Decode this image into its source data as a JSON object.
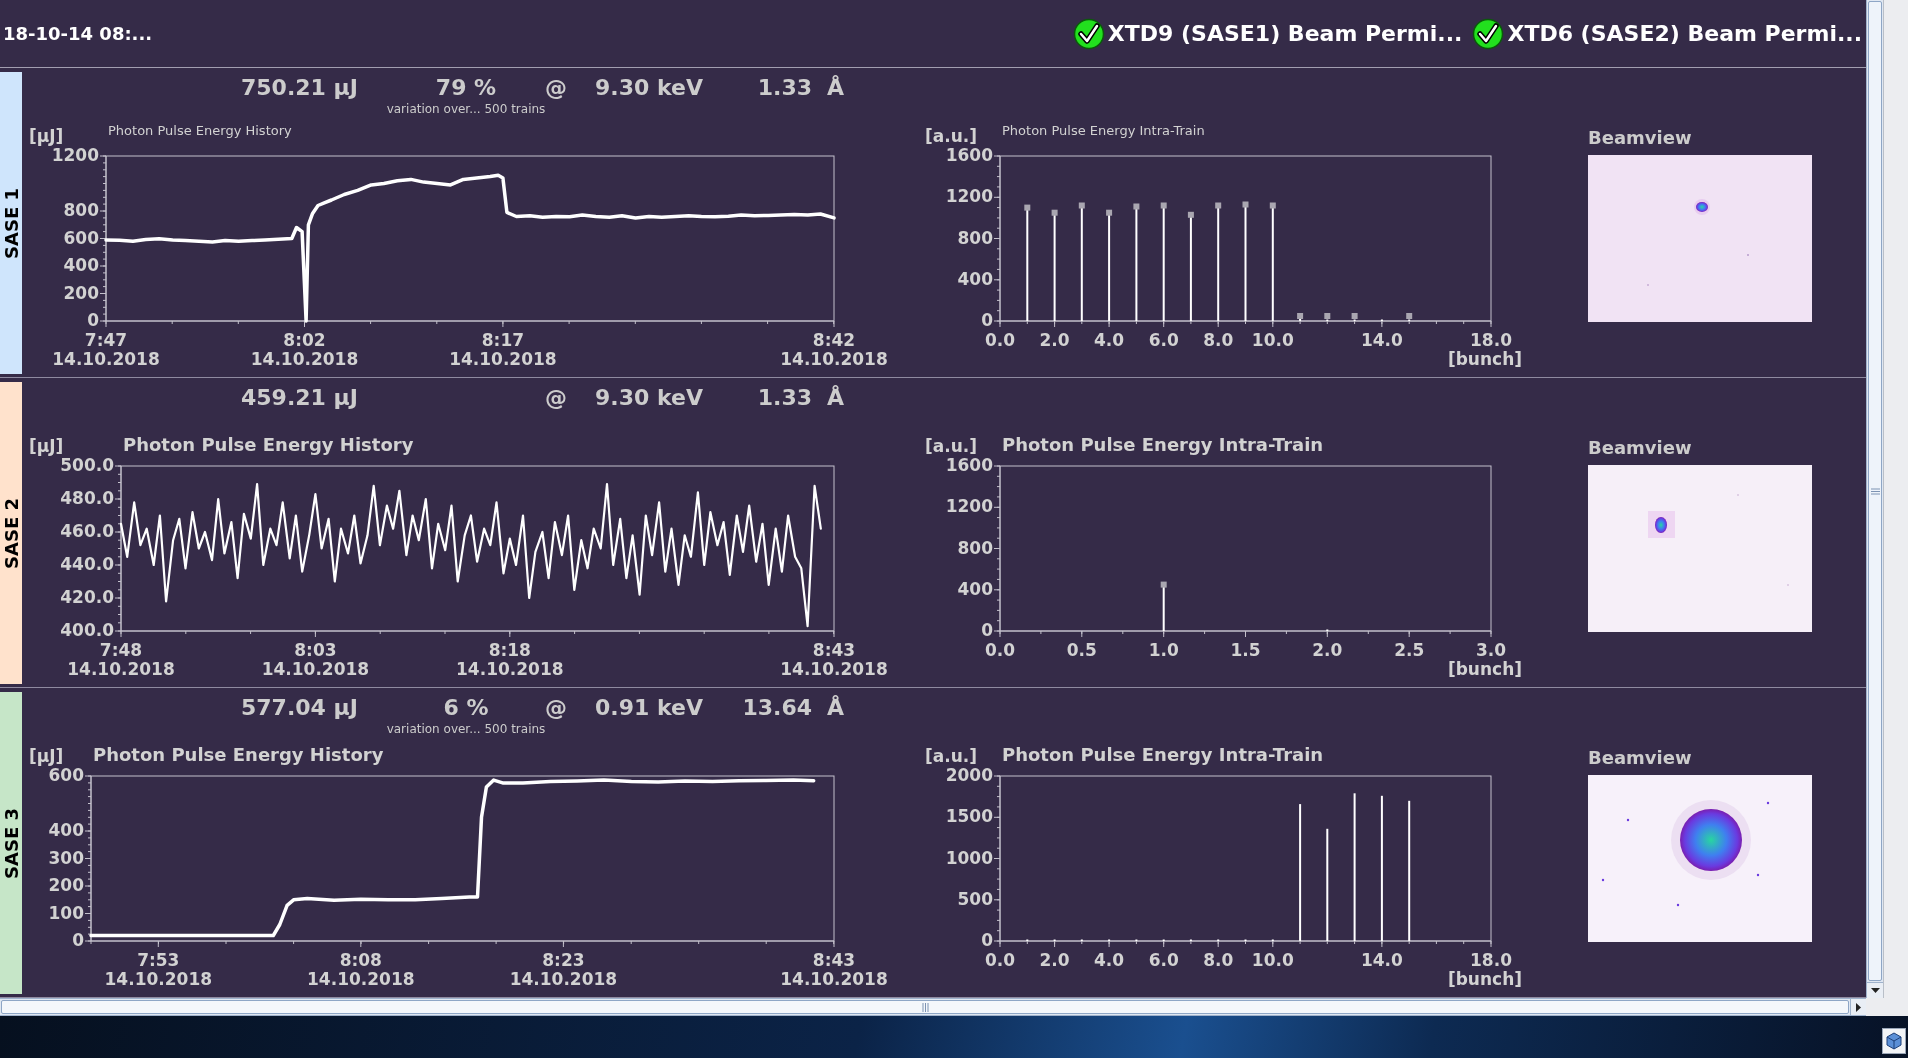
{
  "top_bar": {
    "timestamp": "18-10-14 08:...",
    "statuses": [
      {
        "label": "XTD9 (SASE1) Beam Permi...",
        "ok": true
      },
      {
        "label": "XTD6 (SASE2) Beam Permi...",
        "ok": true
      }
    ]
  },
  "panels": [
    {
      "label": "SASE 1",
      "color": "#cfe5fc",
      "header": {
        "energy": "750.21 µJ",
        "variation": {
          "value": "79 %",
          "note": "variation over... 500 trains"
        },
        "at": "@",
        "photon_energy": "9.30 keV",
        "wavelength": "1.33",
        "wavelength_unit": "Å"
      },
      "history": {
        "title_bold": false,
        "x_tick_dates": [
          "14.10.2018",
          "14.10.2018",
          "14.10.2018",
          "14.10.2018"
        ],
        "chart_data": {
          "type": "line",
          "title": "Photon Pulse Energy History",
          "ylabel": "[µJ]",
          "xlim": [
            7.783,
            8.7
          ],
          "ylim": [
            0,
            1200
          ],
          "yticks": [
            0,
            200,
            400,
            600,
            800,
            1200
          ],
          "xticks": [
            {
              "value": 7.783,
              "label": "7:47"
            },
            {
              "value": 8.033,
              "label": "8:02"
            },
            {
              "value": 8.283,
              "label": "8:17"
            },
            {
              "value": 8.7,
              "label": "8:42"
            }
          ],
          "x": [
            7.783,
            7.8,
            7.817,
            7.833,
            7.85,
            7.867,
            7.883,
            7.9,
            7.917,
            7.933,
            7.95,
            7.967,
            7.983,
            8.0,
            8.017,
            8.023,
            8.03,
            8.035,
            8.038,
            8.043,
            8.05,
            8.058,
            8.067,
            8.083,
            8.1,
            8.117,
            8.133,
            8.15,
            8.167,
            8.183,
            8.2,
            8.217,
            8.233,
            8.25,
            8.267,
            8.277,
            8.283,
            8.288,
            8.3,
            8.317,
            8.333,
            8.35,
            8.367,
            8.383,
            8.4,
            8.417,
            8.433,
            8.45,
            8.467,
            8.483,
            8.5,
            8.517,
            8.533,
            8.55,
            8.567,
            8.583,
            8.6,
            8.617,
            8.633,
            8.65,
            8.667,
            8.683,
            8.7
          ],
          "series": [
            {
              "color": "#ffffff",
              "values": [
                590,
                588,
                580,
                592,
                598,
                590,
                585,
                580,
                575,
                585,
                580,
                585,
                590,
                595,
                600,
                680,
                650,
                0,
                700,
                780,
                840,
                860,
                880,
                920,
                950,
                990,
                1000,
                1020,
                1030,
                1010,
                1000,
                990,
                1030,
                1040,
                1050,
                1060,
                1040,
                790,
                760,
                765,
                755,
                760,
                758,
                770,
                760,
                755,
                765,
                750,
                760,
                755,
                760,
                765,
                760,
                758,
                762,
                770,
                765,
                768,
                772,
                775,
                770,
                778,
                750
              ]
            }
          ]
        }
      },
      "intra_train": {
        "title_bold": false,
        "stem_markers": true,
        "chart_data": {
          "type": "bar",
          "title": "Photon Pulse Energy Intra-Train",
          "ylabel": "[a.u.]",
          "xlabel": "[bunch]",
          "xlim": [
            0,
            18
          ],
          "ylim": [
            0,
            1600
          ],
          "yticks": [
            0,
            400,
            800,
            1200,
            1600
          ],
          "xticks": [
            {
              "value": 0,
              "label": "0.0"
            },
            {
              "value": 2,
              "label": "2.0"
            },
            {
              "value": 4,
              "label": "4.0"
            },
            {
              "value": 6,
              "label": "6.0"
            },
            {
              "value": 8,
              "label": "8.0"
            },
            {
              "value": 10,
              "label": "10.0"
            },
            {
              "value": 14,
              "label": "14.0"
            },
            {
              "value": 18,
              "label": "18.0"
            }
          ],
          "x": [
            1,
            2,
            3,
            4,
            5,
            6,
            7,
            8,
            9,
            10,
            11,
            12,
            13,
            14,
            15
          ],
          "series": [
            {
              "color": "#ffffff",
              "values": [
                1100,
                1050,
                1120,
                1050,
                1110,
                1120,
                1030,
                1120,
                1130,
                1120,
                20,
                10,
                10,
                0,
                10
              ]
            }
          ]
        }
      },
      "beamview": {
        "title": "Beamview"
      }
    },
    {
      "label": "SASE 2",
      "color": "#ffe2cc",
      "header": {
        "energy": "459.21 µJ",
        "at": "@",
        "photon_energy": "9.30 keV",
        "wavelength": "1.33",
        "wavelength_unit": "Å"
      },
      "history": {
        "title_bold": true,
        "x_tick_dates": [
          "14.10.2018",
          "14.10.2018",
          "14.10.2018",
          "14.10.2018"
        ],
        "chart_data": {
          "type": "line",
          "title": "Photon Pulse Energy History",
          "ylabel": "[µJ]",
          "xlim": [
            7.8,
            8.717
          ],
          "ylim": [
            400,
            500
          ],
          "yticks": [
            {
              "value": 400,
              "label": "400.0"
            },
            {
              "value": 420,
              "label": "420.0"
            },
            {
              "value": 440,
              "label": "440.0"
            },
            {
              "value": 460,
              "label": "460.0"
            },
            {
              "value": 480,
              "label": "480.0"
            },
            {
              "value": 500,
              "label": "500.0"
            }
          ],
          "xticks": [
            {
              "value": 7.8,
              "label": "7:48"
            },
            {
              "value": 8.05,
              "label": "8:03"
            },
            {
              "value": 8.3,
              "label": "8:18"
            },
            {
              "value": 8.717,
              "label": "8:43"
            }
          ],
          "x": [
            7.8,
            7.808,
            7.817,
            7.825,
            7.833,
            7.842,
            7.85,
            7.858,
            7.867,
            7.875,
            7.883,
            7.892,
            7.9,
            7.908,
            7.917,
            7.925,
            7.933,
            7.942,
            7.95,
            7.958,
            7.967,
            7.975,
            7.983,
            7.992,
            8.0,
            8.008,
            8.017,
            8.025,
            8.033,
            8.042,
            8.05,
            8.058,
            8.067,
            8.075,
            8.083,
            8.092,
            8.1,
            8.108,
            8.117,
            8.125,
            8.133,
            8.142,
            8.15,
            8.158,
            8.167,
            8.175,
            8.183,
            8.192,
            8.2,
            8.208,
            8.217,
            8.225,
            8.233,
            8.242,
            8.25,
            8.258,
            8.267,
            8.275,
            8.283,
            8.292,
            8.3,
            8.308,
            8.317,
            8.325,
            8.333,
            8.342,
            8.35,
            8.358,
            8.367,
            8.375,
            8.383,
            8.392,
            8.4,
            8.408,
            8.417,
            8.425,
            8.433,
            8.442,
            8.45,
            8.458,
            8.467,
            8.475,
            8.483,
            8.492,
            8.5,
            8.508,
            8.517,
            8.525,
            8.533,
            8.542,
            8.55,
            8.558,
            8.567,
            8.575,
            8.583,
            8.592,
            8.6,
            8.608,
            8.617,
            8.625,
            8.633,
            8.642,
            8.65,
            8.658,
            8.667,
            8.675,
            8.683,
            8.692,
            8.7
          ],
          "series": [
            {
              "color": "#ffffff",
              "values": [
                465,
                445,
                478,
                452,
                462,
                440,
                470,
                418,
                455,
                468,
                438,
                472,
                450,
                460,
                443,
                480,
                447,
                466,
                432,
                471,
                456,
                489,
                440,
                462,
                452,
                478,
                444,
                470,
                436,
                458,
                483,
                450,
                468,
                430,
                462,
                447,
                470,
                441,
                458,
                488,
                452,
                476,
                462,
                485,
                446,
                470,
                455,
                480,
                438,
                465,
                449,
                476,
                430,
                458,
                470,
                442,
                462,
                452,
                478,
                435,
                456,
                440,
                470,
                420,
                448,
                460,
                432,
                466,
                446,
                470,
                425,
                455,
                438,
                462,
                450,
                489,
                440,
                468,
                432,
                458,
                422,
                470,
                446,
                478,
                436,
                462,
                428,
                458,
                445,
                484,
                440,
                472,
                452,
                466,
                434,
                470,
                448,
                476,
                442,
                465,
                428,
                462,
                436,
                470,
                445,
                438,
                403,
                488,
                462
              ]
            }
          ]
        }
      },
      "intra_train": {
        "title_bold": true,
        "stem_markers": true,
        "chart_data": {
          "type": "bar",
          "title": "Photon Pulse Energy Intra-Train",
          "ylabel": "[a.u.]",
          "xlabel": "[bunch]",
          "xlim": [
            0,
            3
          ],
          "ylim": [
            0,
            1600
          ],
          "yticks": [
            0,
            400,
            800,
            1200,
            1600
          ],
          "xticks": [
            {
              "value": 0,
              "label": "0.0"
            },
            {
              "value": 0.5,
              "label": "0.5"
            },
            {
              "value": 1,
              "label": "1.0"
            },
            {
              "value": 1.5,
              "label": "1.5"
            },
            {
              "value": 2,
              "label": "2.0"
            },
            {
              "value": 2.5,
              "label": "2.5"
            },
            {
              "value": 3,
              "label": "3.0"
            }
          ],
          "x": [
            1,
            2
          ],
          "series": [
            {
              "color": "#ffffff",
              "values": [
                450,
                0
              ]
            }
          ]
        }
      },
      "beamview": {
        "title": "Beamview"
      }
    },
    {
      "label": "SASE 3",
      "color": "#c6e6c8",
      "header": {
        "energy": "577.04 µJ",
        "variation": {
          "value": "6 %",
          "note": "variation over... 500 trains"
        },
        "at": "@",
        "photon_energy": "0.91 keV",
        "wavelength": "13.64",
        "wavelength_unit": "Å"
      },
      "history": {
        "title_bold": true,
        "x_tick_dates": [
          "14.10.2018",
          "14.10.2018",
          "14.10.2018",
          "14.10.2018"
        ],
        "chart_data": {
          "type": "line",
          "title": "Photon Pulse Energy History",
          "ylabel": "[µJ]",
          "xlim": [
            7.8,
            8.717
          ],
          "ylim": [
            0,
            600
          ],
          "yticks": [
            0,
            100,
            200,
            300,
            400,
            600
          ],
          "xticks": [
            {
              "value": 7.883,
              "label": "7:53"
            },
            {
              "value": 8.133,
              "label": "8:08"
            },
            {
              "value": 8.383,
              "label": "8:23"
            },
            {
              "value": 8.717,
              "label": "8:43"
            }
          ],
          "x": [
            7.8,
            7.883,
            7.967,
            8.025,
            8.033,
            8.042,
            8.05,
            8.067,
            8.1,
            8.133,
            8.167,
            8.2,
            8.233,
            8.267,
            8.277,
            8.282,
            8.288,
            8.297,
            8.308,
            8.333,
            8.367,
            8.4,
            8.433,
            8.467,
            8.5,
            8.533,
            8.567,
            8.6,
            8.633,
            8.667,
            8.692
          ],
          "series": [
            {
              "color": "#ffffff",
              "values": [
                20,
                20,
                20,
                20,
                60,
                130,
                150,
                155,
                148,
                152,
                150,
                150,
                155,
                160,
                160,
                450,
                560,
                585,
                575,
                575,
                580,
                582,
                585,
                580,
                578,
                582,
                580,
                583,
                584,
                585,
                583
              ]
            }
          ]
        }
      },
      "intra_train": {
        "title_bold": true,
        "stem_markers": false,
        "chart_data": {
          "type": "bar",
          "title": "Photon Pulse Energy Intra-Train",
          "ylabel": "[a.u.]",
          "xlabel": "[bunch]",
          "xlim": [
            0,
            18
          ],
          "ylim": [
            0,
            2000
          ],
          "yticks": [
            0,
            500,
            1000,
            1500,
            2000
          ],
          "xticks": [
            {
              "value": 0,
              "label": "0.0"
            },
            {
              "value": 2,
              "label": "2.0"
            },
            {
              "value": 4,
              "label": "4.0"
            },
            {
              "value": 6,
              "label": "6.0"
            },
            {
              "value": 8,
              "label": "8.0"
            },
            {
              "value": 10,
              "label": "10.0"
            },
            {
              "value": 14,
              "label": "14.0"
            },
            {
              "value": 18,
              "label": "18.0"
            }
          ],
          "x": [
            1,
            2,
            3,
            4,
            5,
            6,
            7,
            8,
            9,
            10,
            11,
            12,
            13,
            14,
            15
          ],
          "series": [
            {
              "color": "#ffffff",
              "values": [
                0,
                0,
                0,
                0,
                0,
                0,
                0,
                0,
                0,
                0,
                1660,
                1360,
                1790,
                1760,
                1700
              ]
            }
          ]
        }
      },
      "beamview": {
        "title": "Beamview"
      }
    }
  ]
}
